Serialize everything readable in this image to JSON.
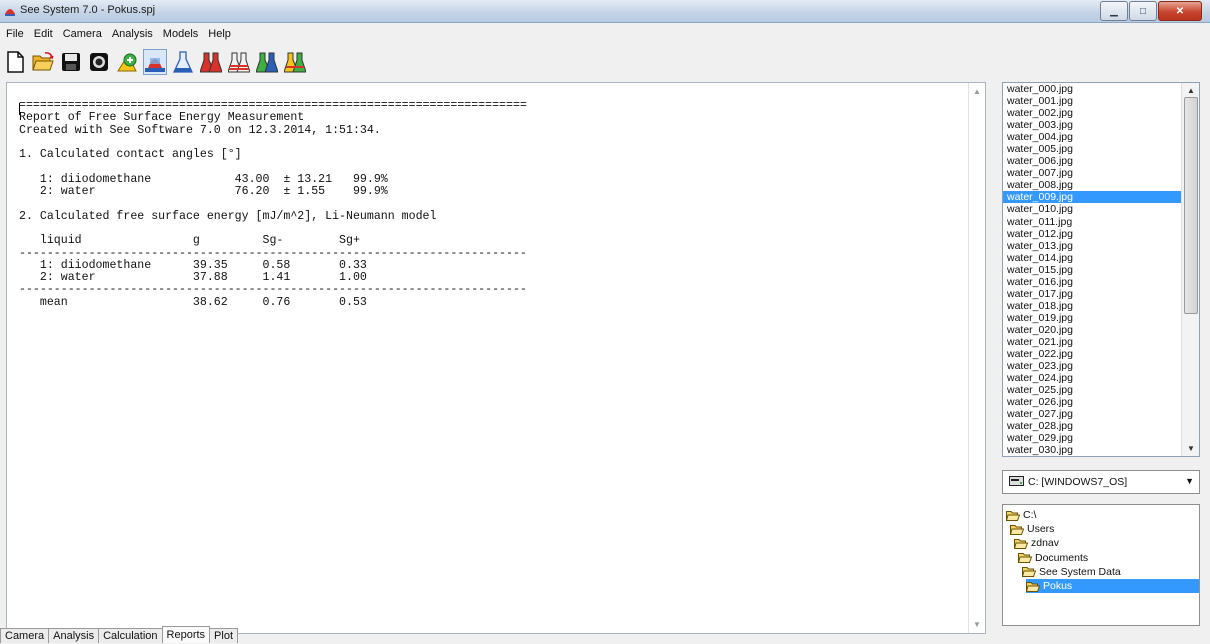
{
  "window": {
    "title": "See System 7.0 - Pokus.spj"
  },
  "menu": [
    "File",
    "Edit",
    "Camera",
    "Analysis",
    "Models",
    "Help"
  ],
  "toolbar": [
    "new-icon",
    "open-icon",
    "save-icon",
    "camera-icon",
    "capture-icon",
    "drop-icon",
    "flask-icon",
    "flask-red-icon",
    "flask-striped-icon",
    "flask-green-icon",
    "flask-yellow-icon"
  ],
  "report": {
    "text": "=========================================================================\nReport of Free Surface Energy Measurement\nCreated with See Software 7.0 on 12.3.2014, 1:51:34.\n\n1. Calculated contact angles [°]\n\n   1: diiodomethane            43.00  ± 13.21   99.9%\n   2: water                    76.20  ± 1.55    99.9%\n\n2. Calculated free surface energy [mJ/m^2], Li-Neumann model\n\n   liquid                g         Sg-        Sg+\n-------------------------------------------------------------------------\n   1: diiodomethane      39.35     0.58       0.33\n   2: water              37.88     1.41       1.00\n-------------------------------------------------------------------------\n   mean                  38.62     0.76       0.53"
  },
  "files": [
    "water_000.jpg",
    "water_001.jpg",
    "water_002.jpg",
    "water_003.jpg",
    "water_004.jpg",
    "water_005.jpg",
    "water_006.jpg",
    "water_007.jpg",
    "water_008.jpg",
    "water_009.jpg",
    "water_010.jpg",
    "water_011.jpg",
    "water_012.jpg",
    "water_013.jpg",
    "water_014.jpg",
    "water_015.jpg",
    "water_016.jpg",
    "water_017.jpg",
    "water_018.jpg",
    "water_019.jpg",
    "water_020.jpg",
    "water_021.jpg",
    "water_022.jpg",
    "water_023.jpg",
    "water_024.jpg",
    "water_025.jpg",
    "water_026.jpg",
    "water_027.jpg",
    "water_028.jpg",
    "water_029.jpg",
    "water_030.jpg"
  ],
  "selected_file": "water_009.jpg",
  "drive": {
    "label": "C: [WINDOWS7_OS]"
  },
  "tree": [
    {
      "label": "C:\\"
    },
    {
      "label": "Users"
    },
    {
      "label": "zdnav"
    },
    {
      "label": "Documents"
    },
    {
      "label": "See System Data"
    },
    {
      "label": "Pokus",
      "selected": true
    }
  ],
  "tabs": [
    "Camera",
    "Analysis",
    "Calculation",
    "Reports",
    "Plot"
  ],
  "active_tab": "Reports",
  "colors": {
    "selection": "#3399ff",
    "close_button": "#c7452f"
  }
}
